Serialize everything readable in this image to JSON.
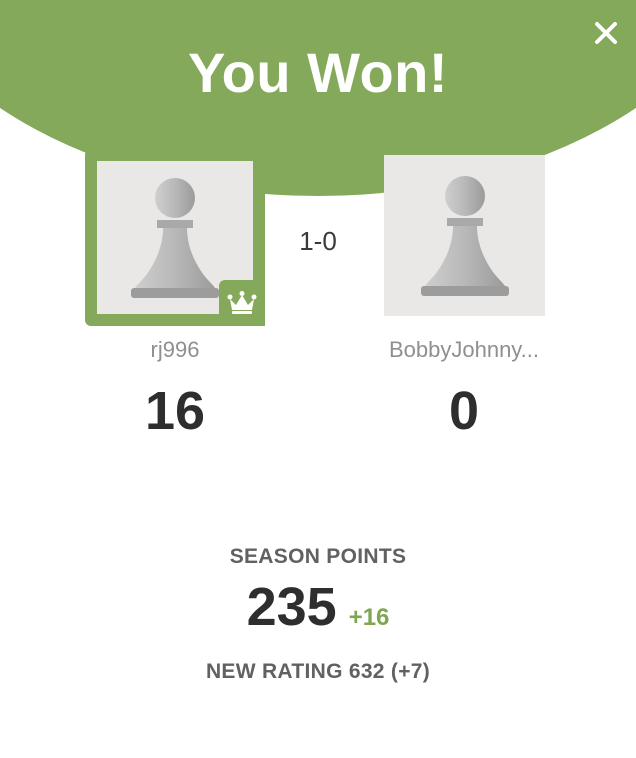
{
  "header": {
    "title": "You Won!",
    "close_label": "×"
  },
  "game": {
    "result": "1-0"
  },
  "players": [
    {
      "name": "rj996",
      "points": "16",
      "winner": true,
      "icon": "pawn-icon"
    },
    {
      "name": "BobbyJohnny...",
      "points": "0",
      "winner": false,
      "icon": "pawn-icon"
    }
  ],
  "season": {
    "label": "SEASON POINTS",
    "value": "235",
    "delta": "+16"
  },
  "rating": {
    "text": "NEW RATING 632 (+7)"
  },
  "colors": {
    "accent_green": "#85a95a",
    "delta_green": "#7fa650",
    "avatar_bg": "#e9e8e6",
    "text_dark": "#2e2e2e",
    "text_muted": "#8f8f8f"
  }
}
